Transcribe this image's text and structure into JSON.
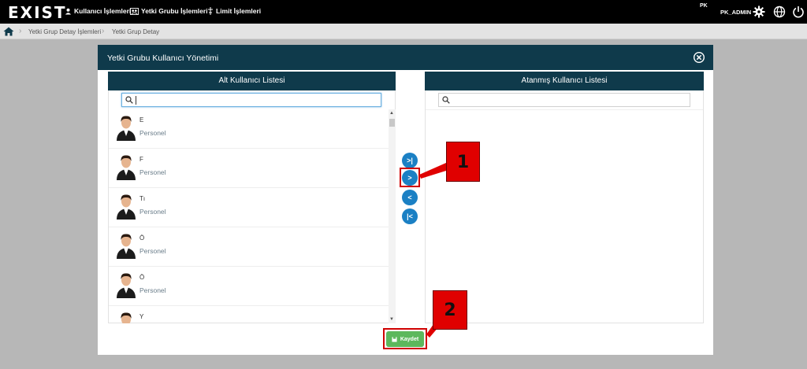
{
  "topbar": {
    "logo": "EXIST",
    "nav": [
      {
        "label": "Kullanıcı İşlemleri",
        "icon": "user-icon"
      },
      {
        "label": "Yetki Grubu İşlemleri",
        "icon": "group-icon"
      },
      {
        "label": "Limit İşlemleri",
        "icon": "limit-icon"
      }
    ],
    "company": "PK",
    "username": "PK_ADMIN",
    "icons": [
      "gear-icon",
      "globe-icon",
      "power-icon"
    ]
  },
  "breadcrumb": {
    "icon": "home-icon",
    "items": [
      "Yetki Grup Detay İşlemleri",
      "Yetki Grup Detay"
    ]
  },
  "modal": {
    "title": "Yetki Grubu Kullanıcı Yönetimi",
    "left_panel": {
      "title": "Alt Kullanıcı Listesi",
      "search_value": "",
      "users": [
        {
          "name": "E",
          "role": "Personel"
        },
        {
          "name": "F",
          "role": "Personel"
        },
        {
          "name": "Tı",
          "role": "Personel"
        },
        {
          "name": "Ö",
          "role": "Personel"
        },
        {
          "name": "Ö",
          "role": "Personel"
        },
        {
          "name": "Y",
          "role": ""
        }
      ]
    },
    "right_panel": {
      "title": "Atanmış Kullanıcı Listesi",
      "search_value": ""
    },
    "move_buttons": [
      ">|",
      ">",
      "<",
      "|<"
    ],
    "save_label": "Kaydet"
  },
  "annotations": [
    {
      "label": "1",
      "target": "move-right-button"
    },
    {
      "label": "2",
      "target": "save-button"
    }
  ],
  "colors": {
    "header": "#0f3a4b",
    "topbar": "#000000",
    "move_button": "#1b80c4",
    "save_button": "#5cb85c",
    "highlight": "#d00000",
    "backdrop": "#b7b7b7"
  }
}
